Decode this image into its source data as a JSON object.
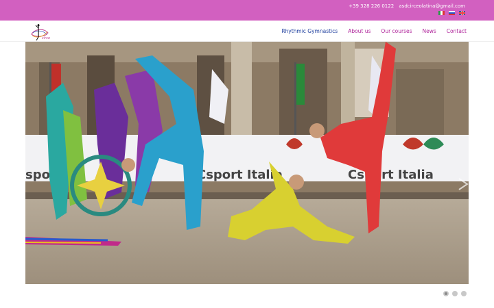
{
  "topbar": {
    "phone": "+39 328 226 0122",
    "email": "asdcirceolatina@gmail.com",
    "languages": [
      "it-flag-icon",
      "ru-flag-icon",
      "gb-flag-icon"
    ]
  },
  "brand": {
    "logo_text": "circe"
  },
  "nav": {
    "items": [
      "Rhythmic Gymnastics",
      "About us",
      "Our courses",
      "News",
      "Contact"
    ],
    "active_index": 0
  },
  "slider": {
    "banner_text": "Csport Italia",
    "banner_text_left": "sport It",
    "slide_count": 3,
    "active_slide": 1
  },
  "colors": {
    "topbar": "#d260c0",
    "nav_link": "#b0279c",
    "nav_active": "#1f3f9e"
  }
}
